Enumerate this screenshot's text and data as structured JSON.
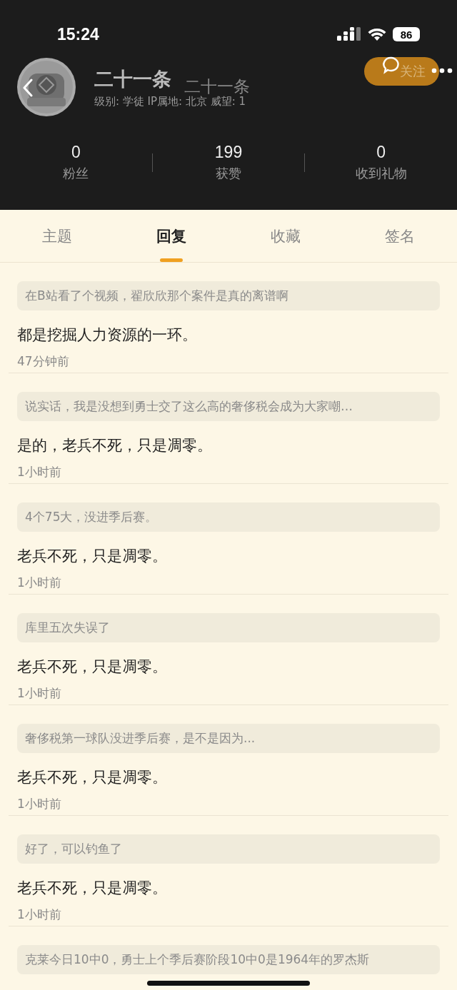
{
  "status_bar": {
    "time": "15:24",
    "battery": "86"
  },
  "profile": {
    "name": "二十一条",
    "nav_title": "二十一条",
    "meta": "级别: 学徒  IP属地: 北京  威望: 1",
    "follow_button": "关注"
  },
  "stats": [
    {
      "value": "0",
      "label": "粉丝"
    },
    {
      "value": "199",
      "label": "获赞"
    },
    {
      "value": "0",
      "label": "收到礼物"
    }
  ],
  "tabs": [
    {
      "label": "主题",
      "selected": false
    },
    {
      "label": "回复",
      "selected": true
    },
    {
      "label": "收藏",
      "selected": false
    },
    {
      "label": "签名",
      "selected": false
    }
  ],
  "replies": [
    {
      "quote": "在B站看了个视频，翟欣欣那个案件是真的离谱啊",
      "text": "都是挖掘人力资源的一环。",
      "time": "47分钟前"
    },
    {
      "quote": "说实话，我是没想到勇士交了这么高的奢侈税会成为大家嘲…",
      "text": "是的，老兵不死，只是凋零。",
      "time": "1小时前"
    },
    {
      "quote": "4个75大，没进季后赛。",
      "text": "老兵不死，只是凋零。",
      "time": "1小时前"
    },
    {
      "quote": "库里五次失误了",
      "text": "老兵不死，只是凋零。",
      "time": "1小时前"
    },
    {
      "quote": "奢侈税第一球队没进季后赛，是不是因为...",
      "text": "老兵不死，只是凋零。",
      "time": "1小时前"
    },
    {
      "quote": "好了，可以钓鱼了",
      "text": "老兵不死，只是凋零。",
      "time": "1小时前"
    },
    {
      "quote": "克莱今日10中0，勇士上个季后赛阶段10中0是1964年的罗杰斯"
    }
  ]
}
